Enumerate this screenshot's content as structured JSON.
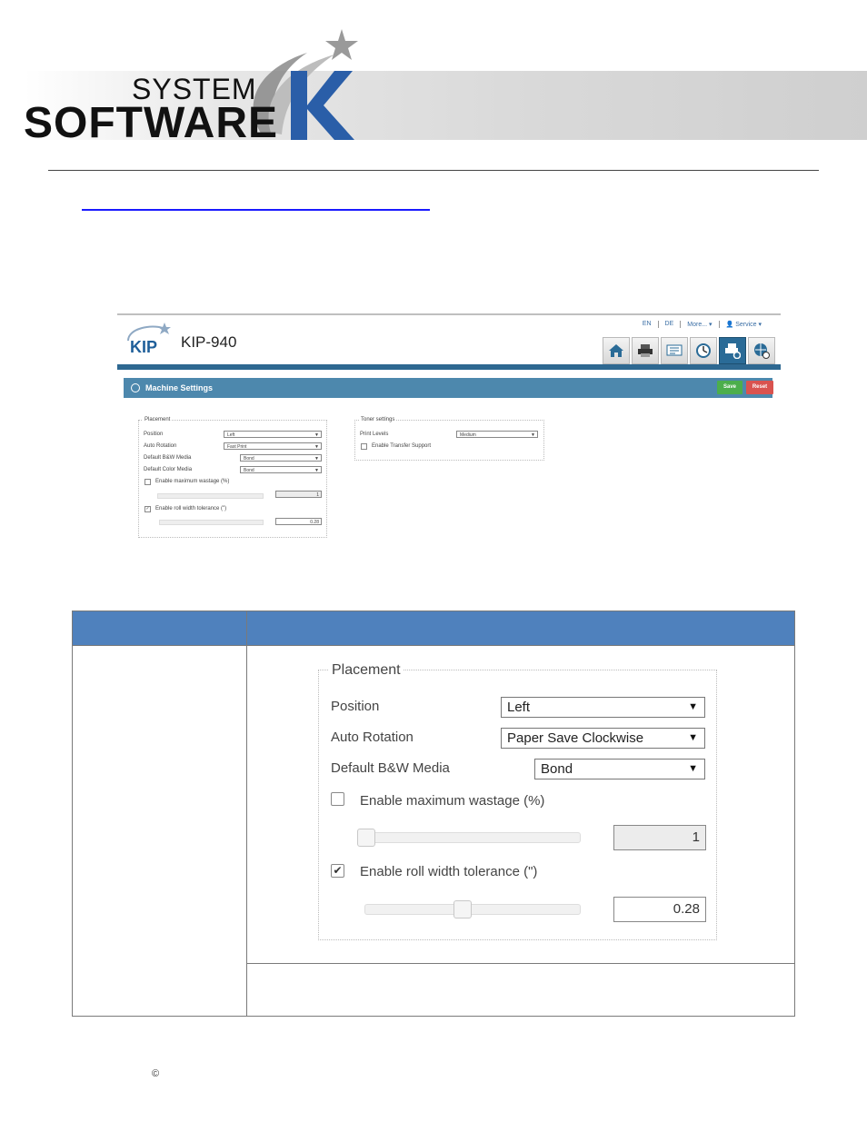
{
  "brand": {
    "system": "SYSTEM",
    "software": "SOFTWARE",
    "k": "K"
  },
  "screenshot": {
    "kip_logo": "KIP",
    "device": "KIP-940",
    "langbar": [
      "EN",
      "DE",
      "More... ▾",
      "👤 Service ▾"
    ],
    "nav_icons": [
      "home-icon",
      "printer-icon",
      "queue-icon",
      "accounting-icon",
      "printer-settings-icon",
      "web-settings-icon"
    ],
    "bar_title": "Machine Settings",
    "save": "Save",
    "reset": "Reset",
    "placement": {
      "legend": "Placement",
      "position_label": "Position",
      "position_value": "Left",
      "rotation_label": "Auto Rotation",
      "rotation_value": "Fast Print",
      "bw_label": "Default B&W Media",
      "bw_value": "Bond",
      "color_label": "Default Color Media",
      "color_value": "Bond",
      "wastage_label": "Enable maximum wastage (%)",
      "wastage_value": "1",
      "tolerance_label": "Enable roll width tolerance (\")",
      "tolerance_value": "0.28"
    },
    "toner": {
      "legend": "Toner settings",
      "levels_label": "Print Levels",
      "levels_value": "Medium",
      "transfer_label": "Enable Transfer Support"
    }
  },
  "panel": {
    "legend": "Placement",
    "position_label": "Position",
    "position_value": "Left",
    "rotation_label": "Auto Rotation",
    "rotation_value": "Paper Save Clockwise",
    "bw_label": "Default B&W Media",
    "bw_value": "Bond",
    "wastage_label": "Enable maximum wastage (%)",
    "wastage_checked": false,
    "wastage_value": "1",
    "tolerance_label": "Enable roll width tolerance (\")",
    "tolerance_checked": true,
    "tolerance_value": "0.28",
    "tolerance_slider_level": 0.45
  },
  "footer": {
    "copyright": "©"
  }
}
